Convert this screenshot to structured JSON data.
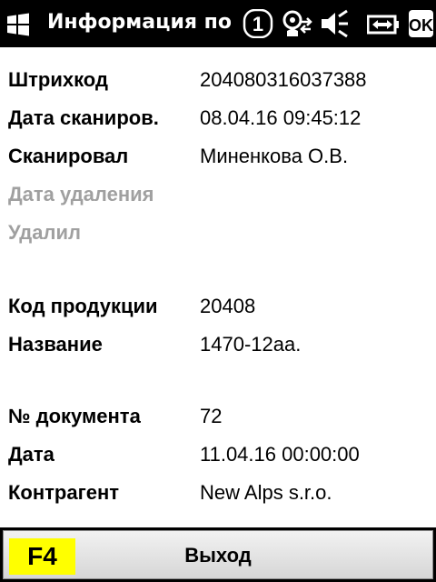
{
  "titlebar": {
    "title": "Информация по ш",
    "icons": [
      "windows-logo-icon",
      "notification-count-icon",
      "connectivity-icon",
      "volume-muted-icon",
      "battery-icon",
      "ok-icon"
    ],
    "notification_count": "1",
    "ok_label": "OK"
  },
  "info": {
    "barcode_label": "Штрихкод",
    "barcode_value": "204080316037388",
    "scan_date_label": "Дата сканиров.",
    "scan_date_value": "08.04.16 09:45:12",
    "scanned_by_label": "Сканировал",
    "scanned_by_value": "Миненкова О.В.",
    "delete_date_label": "Дата удаления",
    "deleted_by_label": "Удалил",
    "product_code_label": "Код продукции",
    "product_code_value": "20408",
    "name_label": "Название",
    "name_value": "1470-12аа.",
    "doc_number_label": "№ документа",
    "doc_number_value": "72",
    "date_label": "Дата",
    "date_value": "11.04.16 00:00:00",
    "counterparty_label": "Контрагент",
    "counterparty_value": "New Alps s.r.o."
  },
  "softkey": {
    "key_label": "F4",
    "action_label": "Выход",
    "key_color": "#ffff00"
  }
}
